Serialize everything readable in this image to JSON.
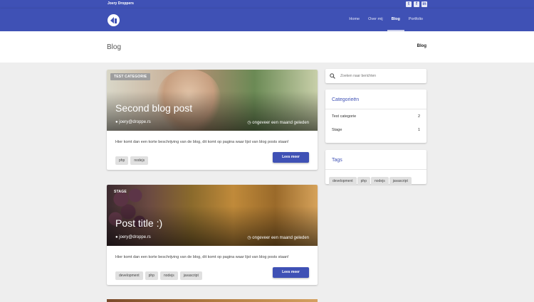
{
  "topbar": {
    "brand": "Joery Droppers",
    "social": [
      "twitter-icon",
      "facebook-icon",
      "linkedin-icon"
    ]
  },
  "navbar": {
    "items": [
      {
        "label": "Home",
        "active": false
      },
      {
        "label": "Over mij",
        "active": false
      },
      {
        "label": "Blog",
        "active": true
      },
      {
        "label": "Portfolio",
        "active": false
      }
    ]
  },
  "page": {
    "title": "Blog",
    "breadcrumb": "Blog"
  },
  "posts": [
    {
      "category": "TEST CATEGORIE",
      "title": "Second blog post",
      "author": "joery@droppe.rs",
      "date": "ongeveer een maand geleden",
      "description": "Hier komt dan een korte beschrijving van de blog, dit komt op pagina waar lijst van blog posts staan!",
      "tags": [
        "php",
        "nodejs"
      ],
      "read_more": "Lees meer"
    },
    {
      "category": "STAGE",
      "title": "Post title :)",
      "author": "joery@droppe.rs",
      "date": "ongeveer een maand geleden",
      "description": "Hier komt dan een korte beschrijving van de blog, dit komt op pagina waar lijst van blog posts staan!",
      "tags": [
        "development",
        "php",
        "nodejs",
        "javascript"
      ],
      "read_more": "Lees meer"
    }
  ],
  "sidebar": {
    "search_placeholder": "Zoeken naar berichten",
    "categories_title": "Categorieën",
    "categories": [
      {
        "name": "Test categorie",
        "count": "2"
      },
      {
        "name": "Stage",
        "count": "1"
      }
    ],
    "tags_title": "Tags",
    "tags": [
      "development",
      "php",
      "nodejs",
      "javascript"
    ]
  },
  "colors": {
    "primary": "#3f51b5",
    "background": "#eeeeee",
    "tag": "#e0e0e0"
  }
}
